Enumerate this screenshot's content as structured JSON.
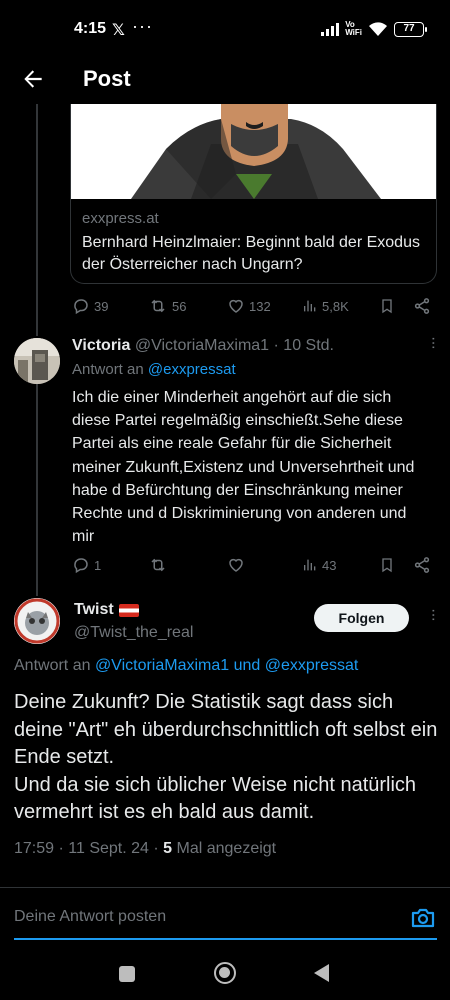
{
  "status_bar": {
    "time": "4:15",
    "x_glyph": "𝕏",
    "dots": "···",
    "vowifi_line1": "Vo",
    "vowifi_line2": "WiFi",
    "battery": "77"
  },
  "header": {
    "title": "Post",
    "back_icon": "arrow-left-icon"
  },
  "link_card": {
    "domain": "exxpress.at",
    "title": "Bernhard Heinzlmaier: Beginnt bald der Exodus der Österreicher nach Ungarn?"
  },
  "parent_actions": {
    "replies": "39",
    "reposts": "56",
    "likes": "132",
    "views": "5,8K"
  },
  "reply": {
    "name": "Victoria",
    "handle_time": "@VictoriaMaxima1 · 10 Std.",
    "reply_prefix": "Antwort an ",
    "reply_mention": "@exxpressat",
    "text": "Ich die einer Minderheit angehört auf die sich diese Partei regelmäßig einschießt.Sehe diese Partei als eine reale Gefahr für die Sicherheit meiner Zukunft,Existenz und Unversehrtheit und habe d Befürchtung der Einschränkung meiner Rechte und d Diskriminierung von anderen und mir",
    "actions": {
      "replies": "1",
      "reposts": "",
      "likes": "",
      "views": "43"
    }
  },
  "main_tweet": {
    "name": "Twist",
    "handle": "@Twist_the_real",
    "follow_label": "Folgen",
    "reply_prefix": "Antwort an ",
    "reply_mention1": "@VictoriaMaxima1",
    "reply_and": " und ",
    "reply_mention2": "@exxpressat",
    "text_line1": "Deine Zukunft? Die Statistik sagt dass sich deine \"Art\" eh überdurchschnittlich oft selbst ein Ende setzt.",
    "text_line2": "Und da sie sich üblicher Weise nicht natürlich vermehrt ist es eh bald aus damit.",
    "meta_prefix": "17:59 · 11 Sept. 24 · ",
    "meta_views": "5",
    "meta_suffix": " Mal angezeigt"
  },
  "reply_box": {
    "placeholder": "Deine Antwort posten",
    "icon": "camera-icon"
  },
  "colors": {
    "accent": "#1d9bf0",
    "muted": "#71767b",
    "background": "#000000"
  }
}
